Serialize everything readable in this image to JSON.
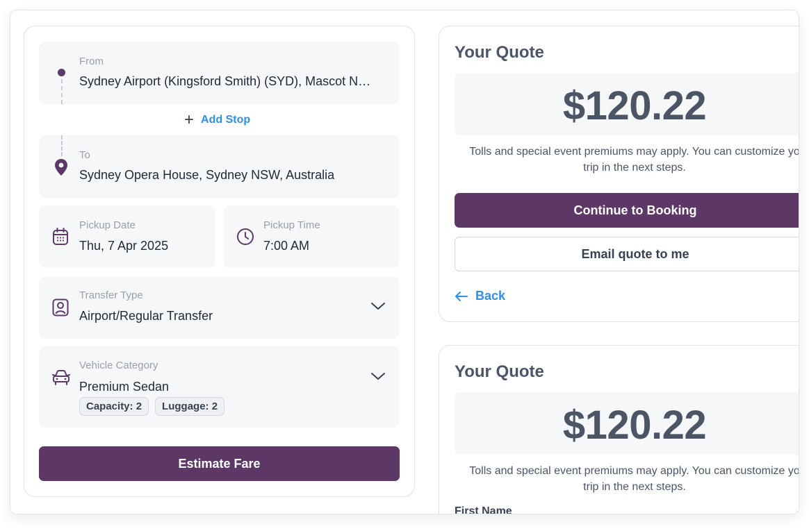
{
  "booking_form": {
    "from": {
      "label": "From",
      "value": "Sydney Airport (Kingsford Smith) (SYD), Mascot N…"
    },
    "add_stop": "Add Stop",
    "to": {
      "label": "To",
      "value": "Sydney Opera House, Sydney NSW, Australia"
    },
    "pickup_date": {
      "label": "Pickup Date",
      "value": "Thu, 7 Apr 2025"
    },
    "pickup_time": {
      "label": "Pickup Time",
      "value": "7:00 AM"
    },
    "transfer_type": {
      "label": "Transfer Type",
      "value": "Airport/Regular Transfer"
    },
    "vehicle_category": {
      "label": "Vehicle Category",
      "value": "Premium Sedan",
      "capacity": "Capacity: 2",
      "luggage": "Luggage: 2"
    },
    "estimate_button": "Estimate Fare"
  },
  "quote_primary": {
    "title": "Your Quote",
    "price": "$120.22",
    "note": "Tolls and special event premiums may apply. You can customize yo\ntrip in the next steps.",
    "continue_button": "Continue to Booking",
    "email_button": "Email quote to me",
    "back_link": "Back"
  },
  "quote_secondary": {
    "title": "Your Quote",
    "price": "$120.22",
    "note": "Tolls and special event premiums may apply. You can customize yo\ntrip in the next steps.",
    "first_name_label": "First Name"
  },
  "icons": {
    "from": "origin-dot-icon",
    "to": "location-pin-icon",
    "date": "calendar-icon",
    "time": "clock-icon",
    "transfer": "id-badge-icon",
    "vehicle": "car-icon",
    "dropdown": "chevron-down-icon",
    "add": "plus-icon",
    "back": "arrow-left-icon"
  },
  "colors": {
    "primary": "#5d3866",
    "link": "#2f8ee5",
    "field_bg": "#f6f7f9",
    "muted_text": "#9aa0a8"
  }
}
